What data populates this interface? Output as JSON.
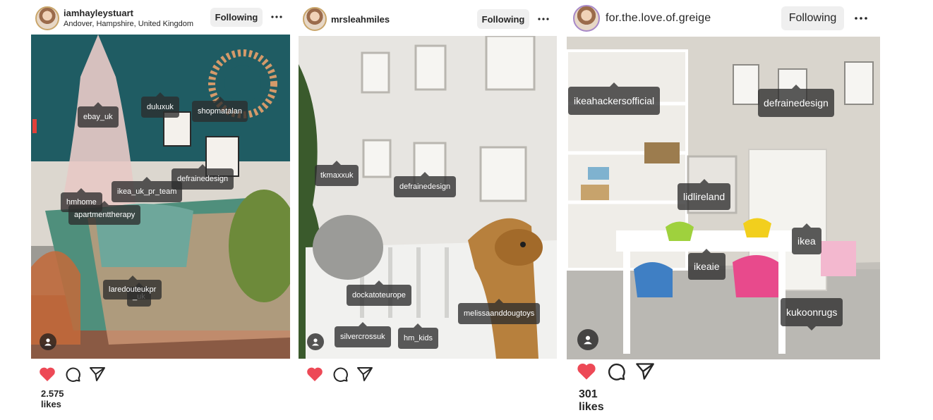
{
  "posts": [
    {
      "username": "iamhayleystuart",
      "location": "Andover, Hampshire, United Kingdom",
      "follow_label": "Following",
      "likes": "2.575 likes",
      "tags": [
        "ebay_uk",
        "duluxuk",
        "shopmatalan",
        "defrainedesign",
        "ikea_uk_pr_team",
        "hmhome",
        "apartmenttherapy",
        "laredouteukpr",
        "_uk"
      ]
    },
    {
      "username": "mrsleahmiles",
      "follow_label": "Following",
      "tags": [
        "tkmaxxuk",
        "defrainedesign",
        "dockatoteurope",
        "melissaanddougtoys",
        "silvercrossuk",
        "hm_kids"
      ]
    },
    {
      "username": "for.the.love.of.greige",
      "follow_label": "Following",
      "likes": "301 likes",
      "tags": [
        "ikeahackersofficial",
        "defrainedesign",
        "lidlireland",
        "ikea",
        "ikeaie",
        "kukoonrugs"
      ]
    }
  ],
  "colors": {
    "like_red": "#ed4956",
    "follow_bg": "#efefef",
    "tag_bg": "#2d2d2d"
  },
  "icons": [
    "heart-icon",
    "comment-icon",
    "share-icon",
    "more-icon",
    "user-tag-icon"
  ]
}
